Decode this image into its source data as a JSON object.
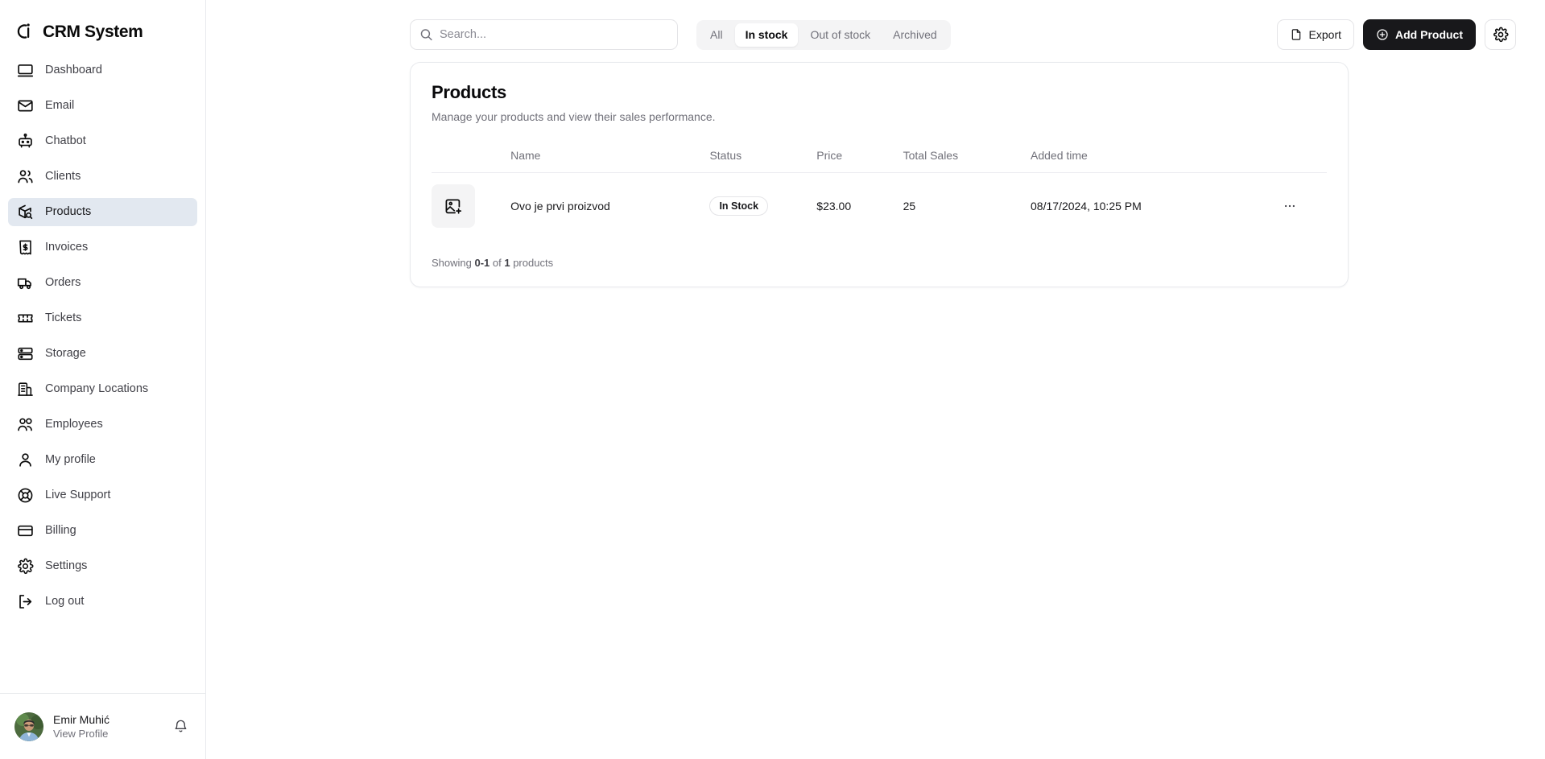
{
  "brand": {
    "name": "CRM System",
    "logo_icon": "crm-logo-icon"
  },
  "sidebar": {
    "items": [
      {
        "label": "Dashboard",
        "icon": "monitor-icon",
        "active": false
      },
      {
        "label": "Email",
        "icon": "mail-icon",
        "active": false
      },
      {
        "label": "Chatbot",
        "icon": "bot-icon",
        "active": false
      },
      {
        "label": "Clients",
        "icon": "users-icon",
        "active": false
      },
      {
        "label": "Products",
        "icon": "package-search-icon",
        "active": true
      },
      {
        "label": "Invoices",
        "icon": "receipt-dollar-icon",
        "active": false
      },
      {
        "label": "Orders",
        "icon": "truck-icon",
        "active": false
      },
      {
        "label": "Tickets",
        "icon": "ticket-icon",
        "active": false
      },
      {
        "label": "Storage",
        "icon": "server-icon",
        "active": false
      },
      {
        "label": "Company Locations",
        "icon": "building-icon",
        "active": false
      },
      {
        "label": "Employees",
        "icon": "users-group-icon",
        "active": false
      },
      {
        "label": "My profile",
        "icon": "user-icon",
        "active": false
      },
      {
        "label": "Live Support",
        "icon": "lifebuoy-icon",
        "active": false
      },
      {
        "label": "Billing",
        "icon": "credit-card-icon",
        "active": false
      },
      {
        "label": "Settings",
        "icon": "gear-icon",
        "active": false
      },
      {
        "label": "Log out",
        "icon": "logout-icon",
        "active": false
      }
    ],
    "user": {
      "name": "Emir Muhić",
      "link": "View Profile",
      "avatar_icon": "avatar-photo",
      "bell_icon": "bell-icon"
    }
  },
  "topbar": {
    "search": {
      "placeholder": "Search...",
      "value": "",
      "icon": "search-icon"
    },
    "filters": [
      {
        "label": "All",
        "active": false
      },
      {
        "label": "In stock",
        "active": true
      },
      {
        "label": "Out of stock",
        "active": false
      },
      {
        "label": "Archived",
        "active": false
      }
    ],
    "export_label": "Export",
    "export_icon": "file-icon",
    "add_label": "Add Product",
    "add_icon": "plus-circle-icon",
    "settings_icon": "gear-icon"
  },
  "card": {
    "title": "Products",
    "subtitle": "Manage your products and view their sales performance.",
    "columns": [
      "",
      "Name",
      "Status",
      "Price",
      "Total Sales",
      "Added time",
      ""
    ],
    "rows": [
      {
        "thumb_icon": "image-plus-icon",
        "name": "Ovo je prvi proizvod",
        "status": "In Stock",
        "price": "$23.00",
        "total_sales": "25",
        "added_time": "08/17/2024, 10:25 PM",
        "actions_icon": "more-horizontal-icon"
      }
    ],
    "footer": {
      "prefix": "Showing ",
      "range": "0-1",
      "middle": " of ",
      "total": "1",
      "suffix": " products"
    }
  },
  "colors": {
    "accent_dark": "#18181b",
    "active_nav_bg": "#e2e8f0",
    "muted_text": "#71717a",
    "border": "#e4e4e7"
  }
}
